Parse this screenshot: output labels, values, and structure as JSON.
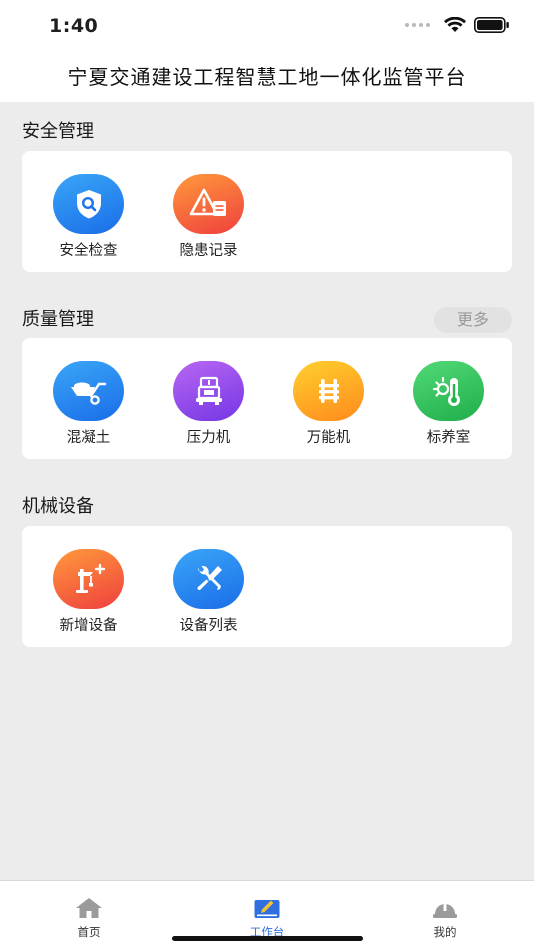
{
  "status": {
    "time": "1:40"
  },
  "header": {
    "title": "宁夏交通建设工程智慧工地一体化监管平台"
  },
  "sections": [
    {
      "title": "安全管理",
      "items": [
        {
          "label": "安全检查",
          "icon": "shield-search-icon"
        },
        {
          "label": "隐患记录",
          "icon": "warning-document-icon"
        }
      ]
    },
    {
      "title": "质量管理",
      "more_label": "更多",
      "items": [
        {
          "label": "混凝土",
          "icon": "wheelbarrow-icon"
        },
        {
          "label": "压力机",
          "icon": "press-machine-icon"
        },
        {
          "label": "万能机",
          "icon": "universal-machine-icon"
        },
        {
          "label": "标养室",
          "icon": "thermometer-sun-icon"
        }
      ]
    },
    {
      "title": "机械设备",
      "items": [
        {
          "label": "新增设备",
          "icon": "add-crane-icon"
        },
        {
          "label": "设备列表",
          "icon": "wrench-screwdriver-icon"
        }
      ]
    }
  ],
  "tabbar": {
    "items": [
      {
        "label": "首页",
        "icon": "home-icon",
        "active": false
      },
      {
        "label": "工作台",
        "icon": "workbench-pen-icon",
        "active": true
      },
      {
        "label": "我的",
        "icon": "hardhat-icon",
        "active": false
      }
    ]
  },
  "colors": {
    "accent": "#2f6fe0",
    "tab_inactive": "#8a8a8a",
    "blue_gradient": [
      "#3aa0f5",
      "#1b6ee8"
    ],
    "orange_gradient": [
      "#ff8a3a",
      "#f0443b"
    ],
    "purple_gradient": [
      "#b160f0",
      "#7a3ae6"
    ],
    "yellow_gradient": [
      "#ffcb2e",
      "#ff8a1e"
    ],
    "green_gradient": [
      "#4fd672",
      "#22b04b"
    ]
  }
}
